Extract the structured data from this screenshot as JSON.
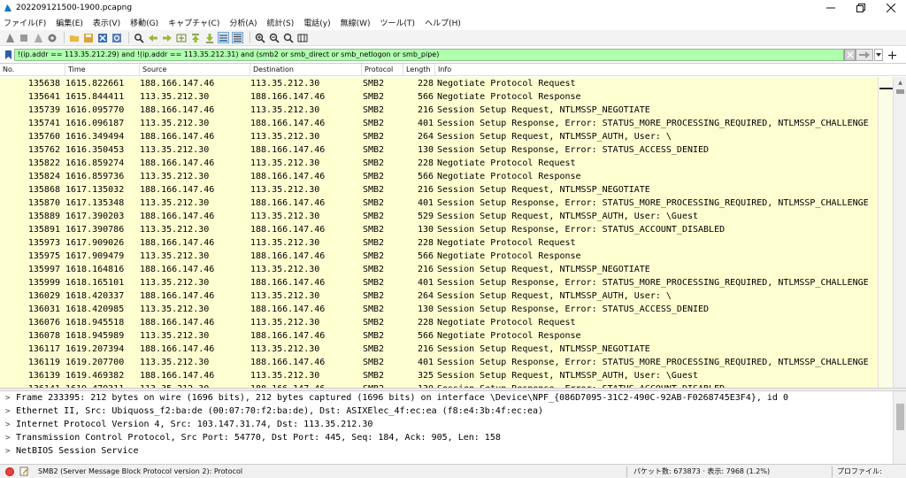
{
  "window": {
    "title": "202209121500-1900.pcapng"
  },
  "menu": [
    "ファイル(F)",
    "編集(E)",
    "表示(V)",
    "移動(G)",
    "キャプチャ(C)",
    "分析(A)",
    "統計(S)",
    "電話(y)",
    "無線(W)",
    "ツール(T)",
    "ヘルプ(H)"
  ],
  "filter": {
    "value": "!(ip.addr == 113.35.212.29) and !(ip.addr == 113.35.212.31) and (smb2 or smb_direct or smb_netlogon or smb_pipe)"
  },
  "packet_list": {
    "columns": [
      "No.",
      "Time",
      "Source",
      "Destination",
      "Protocol",
      "Length",
      "Info"
    ],
    "rows": [
      {
        "no": "135638",
        "time": "1615.822661",
        "src": "188.166.147.46",
        "dst": "113.35.212.30",
        "proto": "SMB2",
        "len": "228",
        "info": "Negotiate Protocol Request"
      },
      {
        "no": "135641",
        "time": "1615.844411",
        "src": "113.35.212.30",
        "dst": "188.166.147.46",
        "proto": "SMB2",
        "len": "566",
        "info": "Negotiate Protocol Response"
      },
      {
        "no": "135739",
        "time": "1616.095770",
        "src": "188.166.147.46",
        "dst": "113.35.212.30",
        "proto": "SMB2",
        "len": "216",
        "info": "Session Setup Request, NTLMSSP_NEGOTIATE"
      },
      {
        "no": "135741",
        "time": "1616.096187",
        "src": "113.35.212.30",
        "dst": "188.166.147.46",
        "proto": "SMB2",
        "len": "401",
        "info": "Session Setup Response, Error: STATUS_MORE_PROCESSING_REQUIRED, NTLMSSP_CHALLENGE"
      },
      {
        "no": "135760",
        "time": "1616.349494",
        "src": "188.166.147.46",
        "dst": "113.35.212.30",
        "proto": "SMB2",
        "len": "264",
        "info": "Session Setup Request, NTLMSSP_AUTH, User: \\"
      },
      {
        "no": "135762",
        "time": "1616.350453",
        "src": "113.35.212.30",
        "dst": "188.166.147.46",
        "proto": "SMB2",
        "len": "130",
        "info": "Session Setup Response, Error: STATUS_ACCESS_DENIED"
      },
      {
        "no": "135822",
        "time": "1616.859274",
        "src": "188.166.147.46",
        "dst": "113.35.212.30",
        "proto": "SMB2",
        "len": "228",
        "info": "Negotiate Protocol Request"
      },
      {
        "no": "135824",
        "time": "1616.859736",
        "src": "113.35.212.30",
        "dst": "188.166.147.46",
        "proto": "SMB2",
        "len": "566",
        "info": "Negotiate Protocol Response"
      },
      {
        "no": "135868",
        "time": "1617.135032",
        "src": "188.166.147.46",
        "dst": "113.35.212.30",
        "proto": "SMB2",
        "len": "216",
        "info": "Session Setup Request, NTLMSSP_NEGOTIATE"
      },
      {
        "no": "135870",
        "time": "1617.135348",
        "src": "113.35.212.30",
        "dst": "188.166.147.46",
        "proto": "SMB2",
        "len": "401",
        "info": "Session Setup Response, Error: STATUS_MORE_PROCESSING_REQUIRED, NTLMSSP_CHALLENGE"
      },
      {
        "no": "135889",
        "time": "1617.390203",
        "src": "188.166.147.46",
        "dst": "113.35.212.30",
        "proto": "SMB2",
        "len": "529",
        "info": "Session Setup Request, NTLMSSP_AUTH, User: \\Guest"
      },
      {
        "no": "135891",
        "time": "1617.390786",
        "src": "113.35.212.30",
        "dst": "188.166.147.46",
        "proto": "SMB2",
        "len": "130",
        "info": "Session Setup Response, Error: STATUS_ACCOUNT_DISABLED"
      },
      {
        "no": "135973",
        "time": "1617.909026",
        "src": "188.166.147.46",
        "dst": "113.35.212.30",
        "proto": "SMB2",
        "len": "228",
        "info": "Negotiate Protocol Request"
      },
      {
        "no": "135975",
        "time": "1617.909479",
        "src": "113.35.212.30",
        "dst": "188.166.147.46",
        "proto": "SMB2",
        "len": "566",
        "info": "Negotiate Protocol Response"
      },
      {
        "no": "135997",
        "time": "1618.164816",
        "src": "188.166.147.46",
        "dst": "113.35.212.30",
        "proto": "SMB2",
        "len": "216",
        "info": "Session Setup Request, NTLMSSP_NEGOTIATE"
      },
      {
        "no": "135999",
        "time": "1618.165101",
        "src": "113.35.212.30",
        "dst": "188.166.147.46",
        "proto": "SMB2",
        "len": "401",
        "info": "Session Setup Response, Error: STATUS_MORE_PROCESSING_REQUIRED, NTLMSSP_CHALLENGE"
      },
      {
        "no": "136029",
        "time": "1618.420337",
        "src": "188.166.147.46",
        "dst": "113.35.212.30",
        "proto": "SMB2",
        "len": "264",
        "info": "Session Setup Request, NTLMSSP_AUTH, User: \\"
      },
      {
        "no": "136031",
        "time": "1618.420985",
        "src": "113.35.212.30",
        "dst": "188.166.147.46",
        "proto": "SMB2",
        "len": "130",
        "info": "Session Setup Response, Error: STATUS_ACCESS_DENIED"
      },
      {
        "no": "136076",
        "time": "1618.945518",
        "src": "188.166.147.46",
        "dst": "113.35.212.30",
        "proto": "SMB2",
        "len": "228",
        "info": "Negotiate Protocol Request"
      },
      {
        "no": "136078",
        "time": "1618.945989",
        "src": "113.35.212.30",
        "dst": "188.166.147.46",
        "proto": "SMB2",
        "len": "566",
        "info": "Negotiate Protocol Response"
      },
      {
        "no": "136117",
        "time": "1619.207394",
        "src": "188.166.147.46",
        "dst": "113.35.212.30",
        "proto": "SMB2",
        "len": "216",
        "info": "Session Setup Request, NTLMSSP_NEGOTIATE"
      },
      {
        "no": "136119",
        "time": "1619.207700",
        "src": "113.35.212.30",
        "dst": "188.166.147.46",
        "proto": "SMB2",
        "len": "401",
        "info": "Session Setup Response, Error: STATUS_MORE_PROCESSING_REQUIRED, NTLMSSP_CHALLENGE"
      },
      {
        "no": "136139",
        "time": "1619.469382",
        "src": "188.166.147.46",
        "dst": "113.35.212.30",
        "proto": "SMB2",
        "len": "325",
        "info": "Session Setup Request, NTLMSSP_AUTH, User: \\Guest"
      },
      {
        "no": "136141",
        "time": "1619.470311",
        "src": "113.35.212.30",
        "dst": "188.166.147.46",
        "proto": "SMB2",
        "len": "130",
        "info": "Session Setup Response, Error: STATUS_ACCOUNT_DISABLED"
      }
    ]
  },
  "details": [
    "Frame 233395: 212 bytes on wire (1696 bits), 212 bytes captured (1696 bits) on interface \\Device\\NPF_{086D7095-31C2-490C-92AB-F0268745E3F4}, id 0",
    "Ethernet II, Src: Ubiquoss_f2:ba:de (00:07:70:f2:ba:de), Dst: ASIXElec_4f:ec:ea (f8:e4:3b:4f:ec:ea)",
    "Internet Protocol Version 4, Src: 103.147.31.74, Dst: 113.35.212.30",
    "Transmission Control Protocol, Src Port: 54770, Dst Port: 445, Seq: 184, Ack: 905, Len: 158",
    "NetBIOS Session Service"
  ],
  "status": {
    "protocol": "SMB2 (Server Message Block Protocol version 2): Protocol",
    "stats": "パケット数: 673873 · 表示: 7968 (1.2%)",
    "profile": "プロファイル: Default"
  },
  "colors": {
    "row_bg": "#feffd0",
    "filter_bg": "#afffaf",
    "capture_stop_red": "#e8413a"
  }
}
